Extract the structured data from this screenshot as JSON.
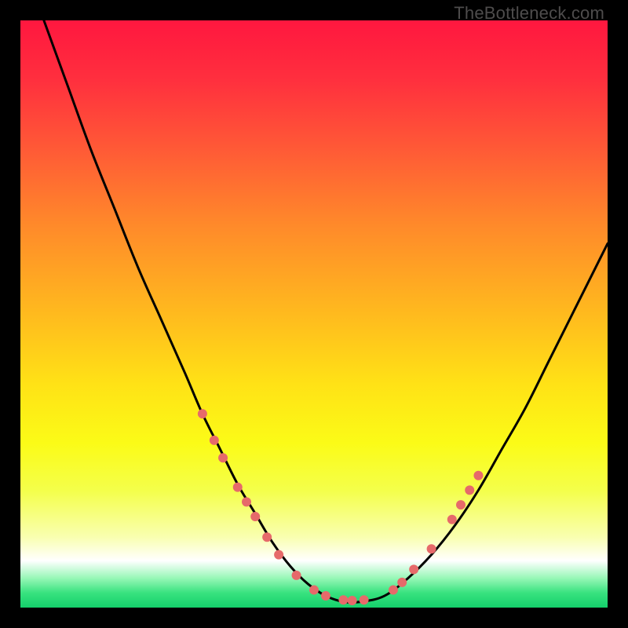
{
  "watermark": "TheBottleneck.com",
  "gradient": {
    "stops": [
      {
        "offset": 0.0,
        "color": "#ff173f"
      },
      {
        "offset": 0.1,
        "color": "#ff2f3e"
      },
      {
        "offset": 0.22,
        "color": "#ff5a36"
      },
      {
        "offset": 0.35,
        "color": "#ff8a2a"
      },
      {
        "offset": 0.5,
        "color": "#ffba1e"
      },
      {
        "offset": 0.62,
        "color": "#ffe216"
      },
      {
        "offset": 0.72,
        "color": "#fbfb17"
      },
      {
        "offset": 0.8,
        "color": "#f4ff4a"
      },
      {
        "offset": 0.88,
        "color": "#f9ffb0"
      },
      {
        "offset": 0.92,
        "color": "#ffffff"
      },
      {
        "offset": 0.95,
        "color": "#97f7b6"
      },
      {
        "offset": 0.975,
        "color": "#38e27f"
      },
      {
        "offset": 1.0,
        "color": "#14d06b"
      }
    ]
  },
  "chart_data": {
    "type": "line",
    "title": "",
    "xlabel": "",
    "ylabel": "",
    "xlim": [
      0,
      100
    ],
    "ylim": [
      0,
      100
    ],
    "series": [
      {
        "name": "bottleneck-curve",
        "x": [
          4,
          8,
          12,
          16,
          20,
          24,
          28,
          31,
          34,
          37,
          40,
          43,
          46,
          49,
          52,
          55,
          58,
          62,
          66,
          70,
          74,
          78,
          82,
          86,
          90,
          94,
          98,
          100
        ],
        "y": [
          100,
          89,
          78,
          68,
          58,
          49,
          40,
          33,
          27,
          21,
          16,
          11,
          7,
          4,
          2,
          1,
          1,
          2,
          5,
          9,
          14,
          20,
          27,
          34,
          42,
          50,
          58,
          62
        ]
      }
    ],
    "markers": {
      "name": "highlight-beads",
      "color": "#e66a6a",
      "radius": 6,
      "points": [
        {
          "x": 31.0,
          "y": 33.0
        },
        {
          "x": 33.0,
          "y": 28.5
        },
        {
          "x": 34.5,
          "y": 25.5
        },
        {
          "x": 37.0,
          "y": 20.5
        },
        {
          "x": 38.5,
          "y": 18.0
        },
        {
          "x": 40.0,
          "y": 15.5
        },
        {
          "x": 42.0,
          "y": 12.0
        },
        {
          "x": 44.0,
          "y": 9.0
        },
        {
          "x": 47.0,
          "y": 5.5
        },
        {
          "x": 50.0,
          "y": 3.0
        },
        {
          "x": 52.0,
          "y": 2.0
        },
        {
          "x": 55.0,
          "y": 1.3
        },
        {
          "x": 56.5,
          "y": 1.2
        },
        {
          "x": 58.5,
          "y": 1.3
        },
        {
          "x": 63.5,
          "y": 3.0
        },
        {
          "x": 65.0,
          "y": 4.3
        },
        {
          "x": 67.0,
          "y": 6.5
        },
        {
          "x": 70.0,
          "y": 10.0
        },
        {
          "x": 73.5,
          "y": 15.0
        },
        {
          "x": 75.0,
          "y": 17.5
        },
        {
          "x": 76.5,
          "y": 20.0
        },
        {
          "x": 78.0,
          "y": 22.5
        }
      ]
    }
  }
}
